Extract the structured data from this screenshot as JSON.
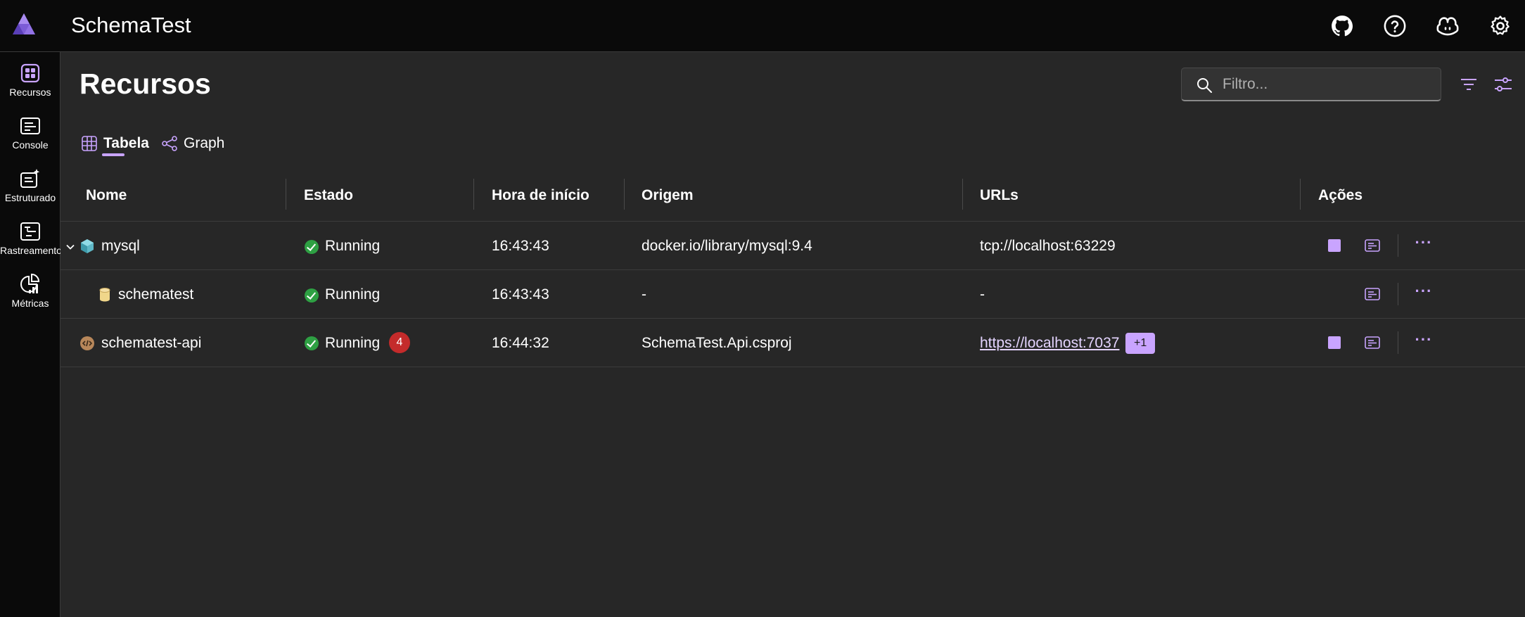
{
  "app": {
    "title": "SchemaTest",
    "accent_color": "#c9a4ff",
    "top_icons": [
      "github-icon",
      "help-icon",
      "copilot-icon",
      "gear-icon"
    ]
  },
  "sidebar": {
    "items": [
      {
        "label": "Recursos",
        "icon": "resources-icon"
      },
      {
        "label": "Console",
        "icon": "console-icon"
      },
      {
        "label": "Estruturado",
        "icon": "structured-logs-icon"
      },
      {
        "label": "Rastreamentos",
        "icon": "traces-icon"
      },
      {
        "label": "Métricas",
        "icon": "metrics-icon"
      }
    ]
  },
  "main": {
    "title": "Recursos",
    "filter_placeholder": "Filtro...",
    "tabs": [
      {
        "label": "Tabela",
        "icon": "table-icon",
        "selected": true
      },
      {
        "label": "Graph",
        "icon": "graph-icon",
        "selected": false
      }
    ],
    "columns": [
      "Nome",
      "Estado",
      "Hora de início",
      "Origem",
      "URLs",
      "Ações"
    ],
    "rows": [
      {
        "name": "mysql",
        "state": "Running",
        "start": "16:43:43",
        "origin": "docker.io/library/mysql:9.4",
        "url": "tcp://localhost:63229",
        "expandable": true
      },
      {
        "name": "schematest",
        "state": "Running",
        "start": "16:43:43",
        "origin": "-",
        "url": "-",
        "expandable": false
      },
      {
        "name": "schematest-api",
        "state": "Running",
        "error_count": "4",
        "start": "16:44:32",
        "origin": "SchemaTest.Api.csproj",
        "url": "https://localhost:7037",
        "url_more": "+1",
        "expandable": false
      }
    ]
  }
}
